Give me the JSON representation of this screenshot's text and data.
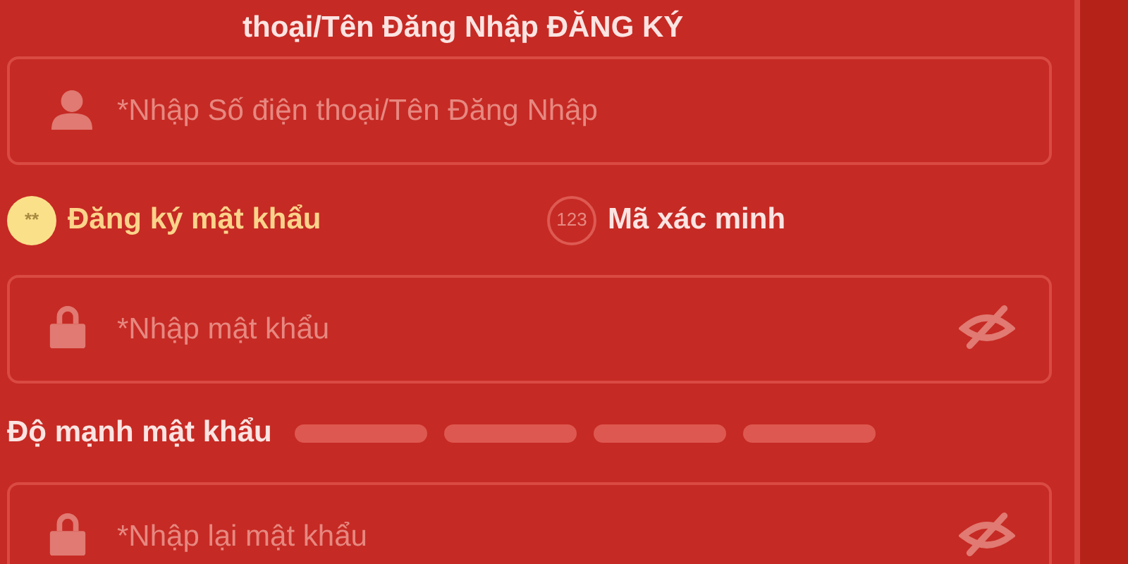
{
  "header": {
    "text": "thoại/Tên Đăng Nhập ĐĂNG KÝ"
  },
  "username_field": {
    "placeholder": "*Nhập Số điện thoại/Tên Đăng Nhập"
  },
  "tabs": [
    {
      "badge": "**",
      "label": "Đăng ký mật khẩu",
      "selected": true
    },
    {
      "badge": "123",
      "label": "Mã xác minh",
      "selected": false
    }
  ],
  "password_field": {
    "placeholder": "*Nhập mật khẩu"
  },
  "strength": {
    "label": "Độ mạnh mật khẩu"
  },
  "confirm_field": {
    "placeholder": "*Nhập lại mật khẩu"
  }
}
